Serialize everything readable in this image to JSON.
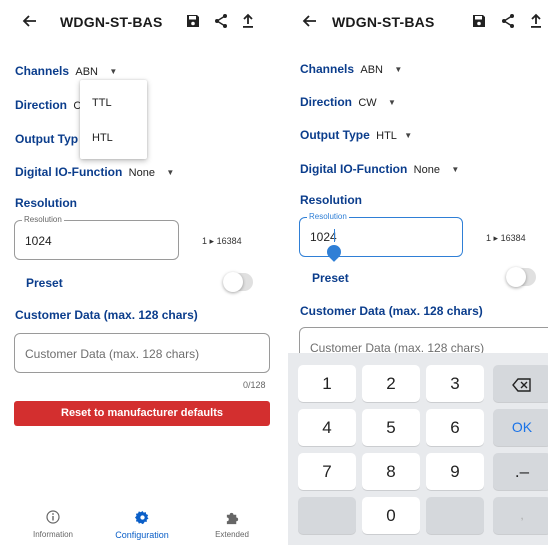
{
  "left": {
    "title": "WDGN-ST-BAS",
    "channels_label": "Channels",
    "channels_value": "ABN",
    "direction_label": "Direction",
    "direction_value": "C",
    "dropdown_options": [
      "TTL",
      "HTL"
    ],
    "output_type_label": "Output Typ",
    "digital_io_label": "Digital IO-Function",
    "digital_io_value": "None",
    "resolution_heading": "Resolution",
    "resolution_field_label": "Resolution",
    "resolution_value": "1024",
    "range_min": "1",
    "range_arrow": "▸",
    "range_max": "16384",
    "preset_label": "Preset",
    "customer_heading": "Customer Data (max. 128 chars)",
    "customer_placeholder": "Customer Data (max. 128 chars)",
    "counter": "0/128",
    "reset_label": "Reset to manufacturer defaults",
    "nav": [
      {
        "label": "Information",
        "icon": "info-icon"
      },
      {
        "label": "Configuration",
        "icon": "gear-icon"
      },
      {
        "label": "Extended",
        "icon": "puzzle-icon"
      }
    ]
  },
  "right": {
    "title": "WDGN-ST-BAS",
    "channels_label": "Channels",
    "channels_value": "ABN",
    "direction_label": "Direction",
    "direction_value": "CW",
    "output_type_label": "Output Type",
    "output_type_value": "HTL",
    "digital_io_label": "Digital IO-Function",
    "digital_io_value": "None",
    "resolution_heading": "Resolution",
    "resolution_field_label": "Resolution",
    "resolution_value": "1024",
    "range_min": "1",
    "range_arrow": "▸",
    "range_max": "16384",
    "preset_label": "Preset",
    "customer_heading": "Customer Data (max. 128 chars)",
    "customer_placeholder": "Customer Data (max. 128 chars)",
    "keys": {
      "k1": "1",
      "k2": "2",
      "k3": "3",
      "k4": "4",
      "k5": "5",
      "k6": "6",
      "ok": "OK",
      "k7": "7",
      "k8": "8",
      "k9": "9",
      "dot_dash": ".–",
      "k0": "0",
      "comma": ","
    }
  },
  "colors": {
    "accent_blue": "#0b3d8c",
    "focus_blue": "#2f7fd6",
    "reset_red": "#d32f2f",
    "nav_active": "#0b5fc8"
  }
}
